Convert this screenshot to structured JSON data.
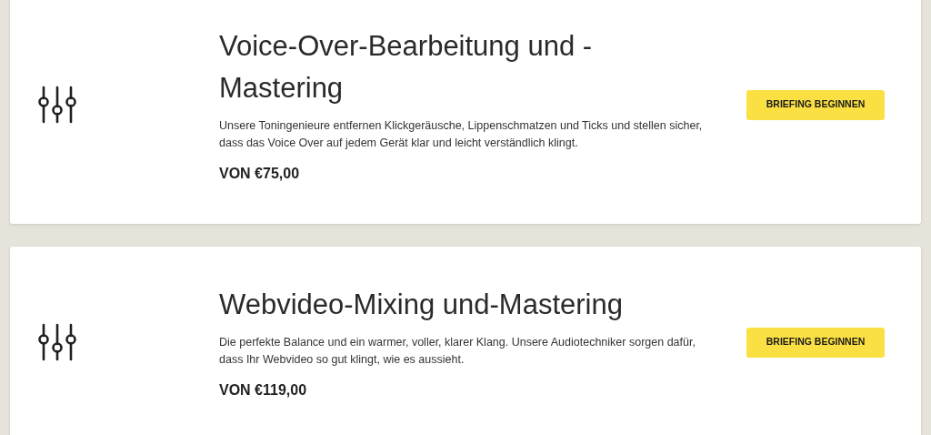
{
  "services": [
    {
      "title": "Voice-Over-Bearbeitung und -Mastering",
      "description": "Unsere Toningenieure entfernen Klickgeräusche, Lippenschmatzen und Ticks und stellen sicher, dass das Voice Over auf jedem Gerät klar und leicht verständlich klingt.",
      "price": "VON €75,00",
      "button": "BRIEFING BEGINNEN"
    },
    {
      "title": "Webvideo-Mixing und-Mastering",
      "description": "Die perfekte Balance und ein warmer, voller, klarer Klang. Unsere Audiotechniker sorgen dafür, dass Ihr Webvideo so gut klingt, wie es aussieht.",
      "price": "VON €119,00",
      "button": "BRIEFING BEGINNEN"
    }
  ]
}
